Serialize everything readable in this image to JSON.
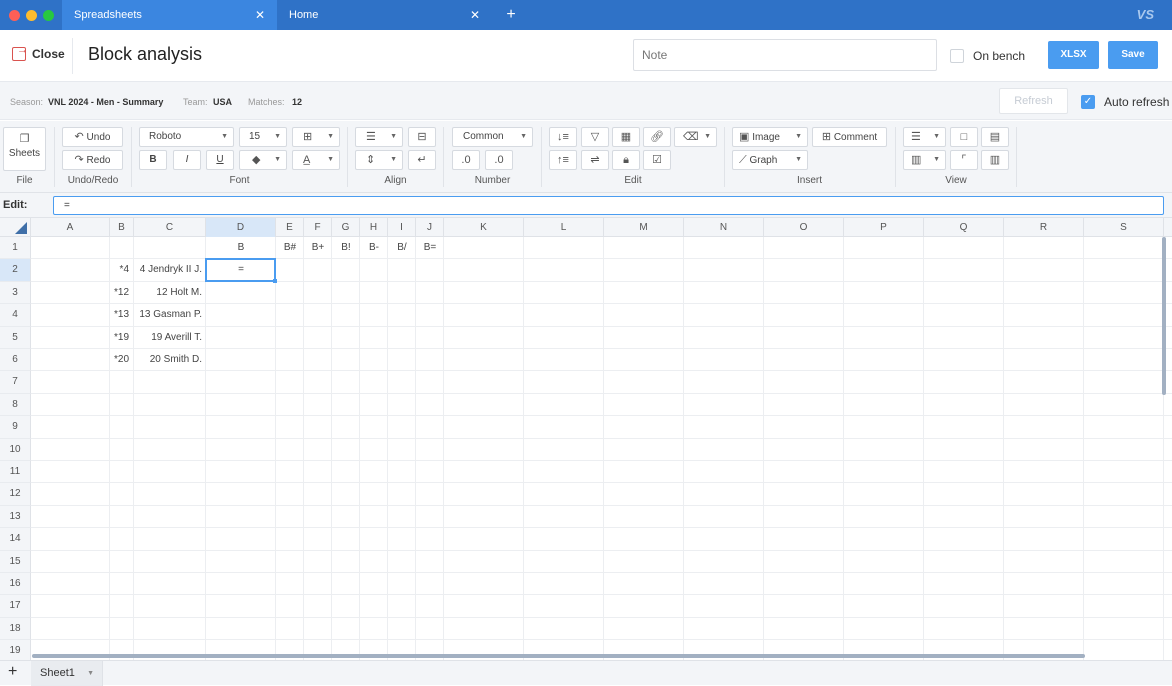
{
  "window": {
    "tabs": [
      {
        "label": "Spreadsheets",
        "active": true
      },
      {
        "label": "Home",
        "active": false
      }
    ],
    "new_tab_symbol": "+",
    "close_symbol": "✕",
    "logo": "VS"
  },
  "header": {
    "close_label": "Close",
    "title": "Block analysis",
    "note_placeholder": "Note",
    "on_bench_label": "On bench",
    "xlsx_label": "XLSX",
    "save_label": "Save"
  },
  "info": {
    "season_label": "Season:",
    "season_value": "VNL 2024 - Men - Summary",
    "team_label": "Team:",
    "team_value": "USA",
    "matches_label": "Matches:",
    "matches_value": "12",
    "refresh_label": "Refresh",
    "auto_refresh_label": "Auto refresh",
    "auto_refresh_checked": true
  },
  "toolbar": {
    "file": {
      "sheets_label": "Sheets",
      "group_label": "File"
    },
    "undo": {
      "undo_label": "Undo",
      "redo_label": "Redo",
      "group_label": "Undo/Redo"
    },
    "font": {
      "family": "Roboto",
      "size": "15",
      "bold": "B",
      "italic": "I",
      "underline": "U",
      "group_label": "Font"
    },
    "align": {
      "group_label": "Align"
    },
    "number": {
      "format": "Common",
      "group_label": "Number"
    },
    "edit": {
      "group_label": "Edit"
    },
    "insert": {
      "image_label": "Image",
      "comment_label": "Comment",
      "graph_label": "Graph",
      "group_label": "Insert"
    },
    "view": {
      "group_label": "View"
    }
  },
  "edit_bar": {
    "label": "Edit:",
    "value": "="
  },
  "columns": [
    "A",
    "B",
    "C",
    "D",
    "E",
    "F",
    "G",
    "H",
    "I",
    "J",
    "K",
    "L",
    "M",
    "N",
    "O",
    "P",
    "Q",
    "R",
    "S"
  ],
  "selected_column": "D",
  "rows": [
    "1",
    "2",
    "3",
    "4",
    "5",
    "6",
    "7",
    "8",
    "9",
    "10",
    "11",
    "12",
    "13",
    "14",
    "15",
    "16",
    "17",
    "18",
    "19"
  ],
  "selected_row": "2",
  "cells": {
    "D1": "B",
    "E1": "B#",
    "F1": "B+",
    "G1": "B!",
    "H1": "B-",
    "I1": "B/",
    "J1": "B=",
    "B2": "*4",
    "C2": "4 Jendryk II J.",
    "D2": "=",
    "B3": "*12",
    "C3": "12 Holt M.",
    "B4": "*13",
    "C4": "13 Gasman P.",
    "B5": "*19",
    "C5": "19 Averill T.",
    "B6": "*20",
    "C6": "20 Smith D."
  },
  "sheets": [
    {
      "label": "Sheet1"
    }
  ],
  "add_sheet_symbol": "+"
}
